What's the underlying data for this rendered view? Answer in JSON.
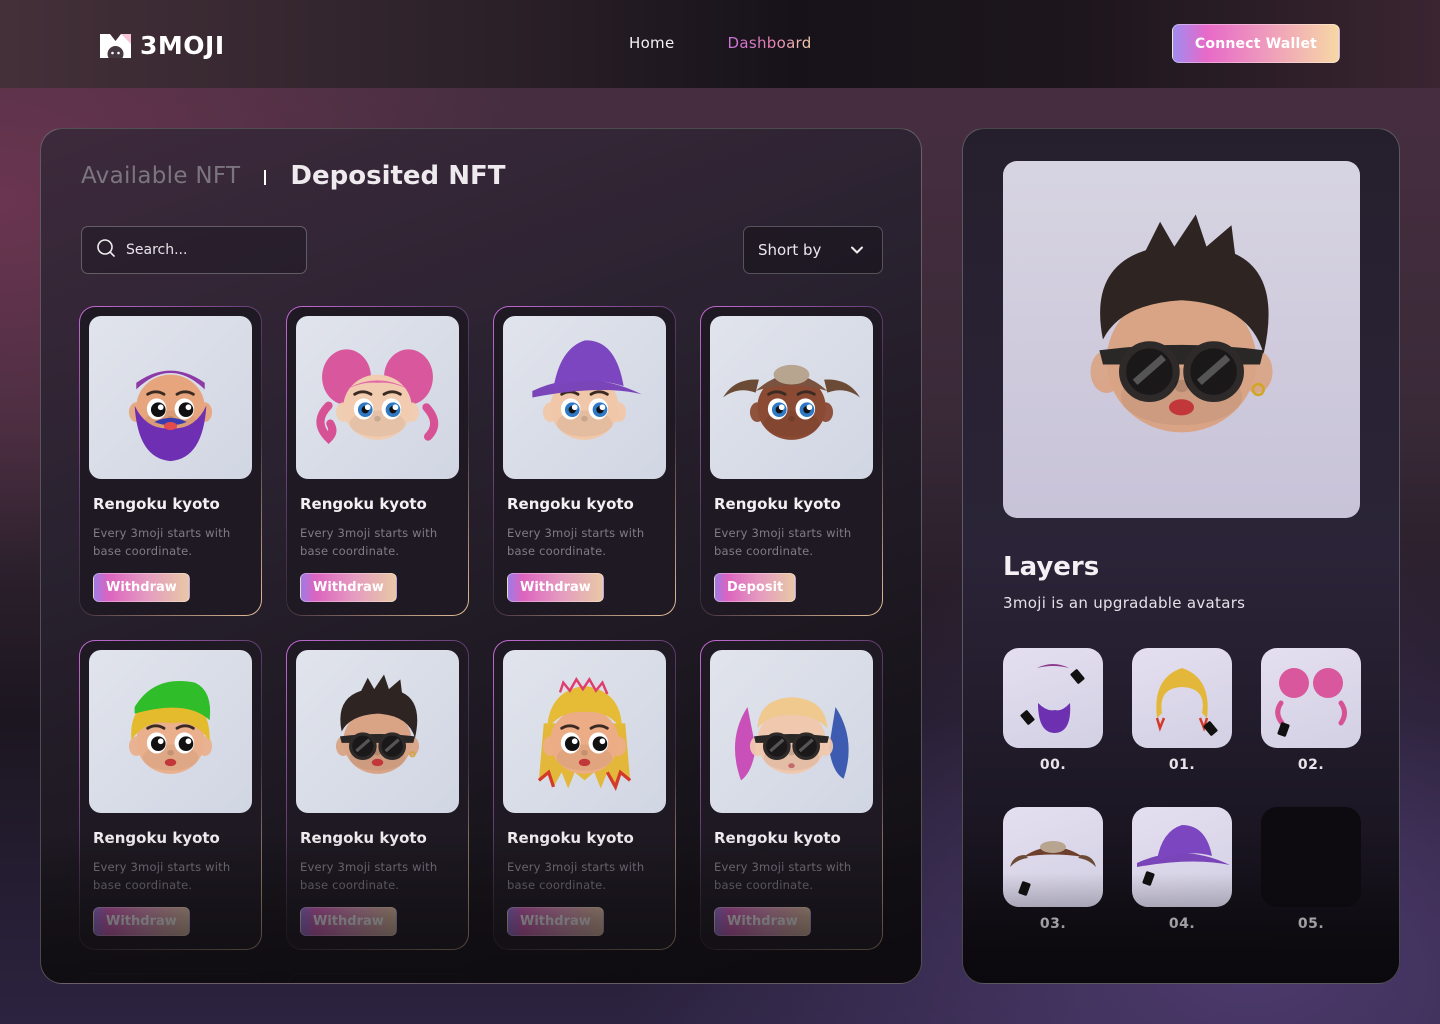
{
  "header": {
    "brand": "3MOJI",
    "nav": [
      {
        "label": "Home",
        "active": false
      },
      {
        "label": "Dashboard",
        "active": true
      }
    ],
    "connect_wallet_label": "Connect Wallet"
  },
  "main": {
    "tabs": [
      {
        "label": "Available NFT",
        "active": false
      },
      {
        "label": "Deposited NFT",
        "active": true
      }
    ],
    "search": {
      "placeholder": "Search...",
      "value": ""
    },
    "sort": {
      "label": "Short by"
    },
    "cards": [
      {
        "title": "Rengoku kyoto",
        "description": "Every 3moji starts with base coordinate.",
        "action": "Withdraw",
        "avatar": "purple-beard"
      },
      {
        "title": "Rengoku kyoto",
        "description": "Every 3moji starts with base coordinate.",
        "action": "Withdraw",
        "avatar": "pink-tentacle-hair"
      },
      {
        "title": "Rengoku kyoto",
        "description": "Every 3moji starts with base coordinate.",
        "action": "Withdraw",
        "avatar": "purple-witch-hat"
      },
      {
        "title": "Rengoku kyoto",
        "description": "Every 3moji starts with base coordinate.",
        "action": "Deposit",
        "avatar": "horned-helmet"
      },
      {
        "title": "Rengoku kyoto",
        "description": "Every 3moji starts with base coordinate.",
        "action": "Withdraw",
        "avatar": "green-cap-blonde"
      },
      {
        "title": "Rengoku kyoto",
        "description": "Every 3moji starts with base coordinate.",
        "action": "Withdraw",
        "avatar": "sunglasses-dark-hair"
      },
      {
        "title": "Rengoku kyoto",
        "description": "Every 3moji starts with base coordinate.",
        "action": "Withdraw",
        "avatar": "flame-blonde-hair"
      },
      {
        "title": "Rengoku kyoto",
        "description": "Every 3moji starts with base coordinate.",
        "action": "Withdraw",
        "avatar": "pigtails-sunglasses"
      }
    ]
  },
  "side": {
    "preview_avatar": "sunglasses-dark-hair",
    "layers_title": "Layers",
    "layers_subtitle": "3moji is an upgradable avatars",
    "layers": [
      {
        "label": "00.",
        "item": "eyebrow-and-beard"
      },
      {
        "label": "01.",
        "item": "flame-hair"
      },
      {
        "label": "02.",
        "item": "pink-tentacle-hair"
      },
      {
        "label": "03.",
        "item": "horned-helmet"
      },
      {
        "label": "04.",
        "item": "witch-hat"
      },
      {
        "label": "05.",
        "item": "empty"
      }
    ]
  },
  "colors": {
    "accent_gradient": [
      "#9f8cf0",
      "#e769c8",
      "#ee99bd",
      "#f7d8a5"
    ],
    "panel_bg": "#1e1922",
    "muted_text": "#817b86"
  }
}
